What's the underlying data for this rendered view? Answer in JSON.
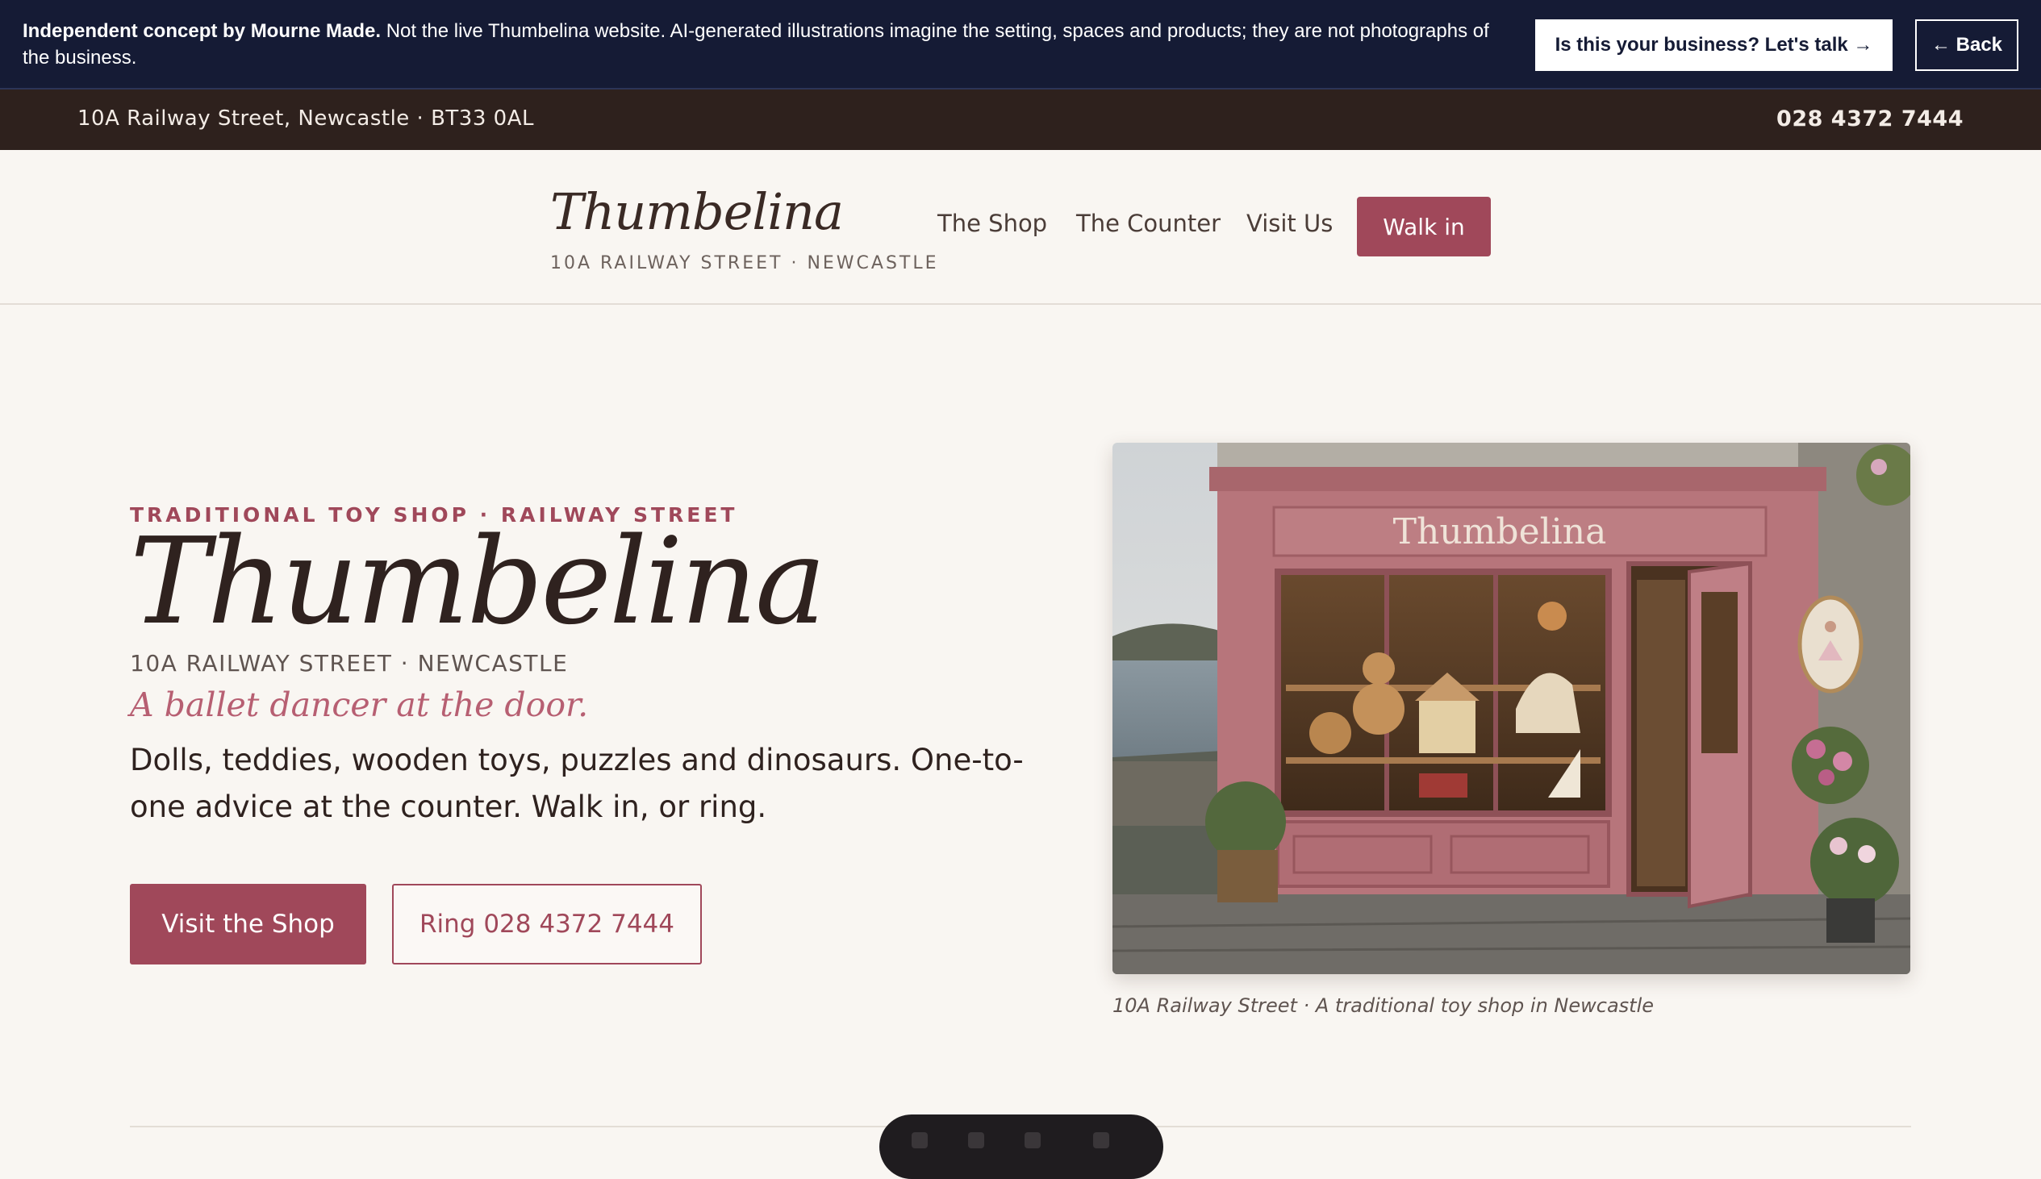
{
  "concept_banner": {
    "bold": "Independent concept by Mourne Made.",
    "text": " Not the live Thumbelina website. AI-generated illustrations imagine the setting, spaces and products; they are not photographs of the business.",
    "cta_label": "Is this your business? Let's talk →",
    "back_label": "← Back"
  },
  "top_strip": {
    "address": "10A Railway Street, Newcastle · BT33 0AL",
    "phone": "028 4372 7444"
  },
  "header": {
    "logo": "Thumbelina",
    "logo_sub": "10A RAILWAY STREET · NEWCASTLE",
    "nav": [
      "The Shop",
      "The Counter",
      "Visit Us"
    ],
    "cta": "Walk in"
  },
  "hero": {
    "kicker": "TRADITIONAL TOY SHOP · RAILWAY STREET",
    "title": "Thumbelina",
    "address": "10A RAILWAY STREET · NEWCASTLE",
    "tagline": "A ballet dancer at the door.",
    "description": "Dolls, teddies, wooden toys, puzzles and dinosaurs. One-to-one advice at the counter. Walk in, or ring.",
    "primary_button": "Visit the Shop",
    "secondary_button": "Ring 028 4372 7444",
    "photo_sign": "Thumbelina",
    "caption": "10A Railway Street · A traditional toy shop in Newcastle"
  },
  "colors": {
    "banner": "#151b35",
    "strip": "#2e211d",
    "accent": "#a0485a",
    "background": "#f9f6f2"
  }
}
